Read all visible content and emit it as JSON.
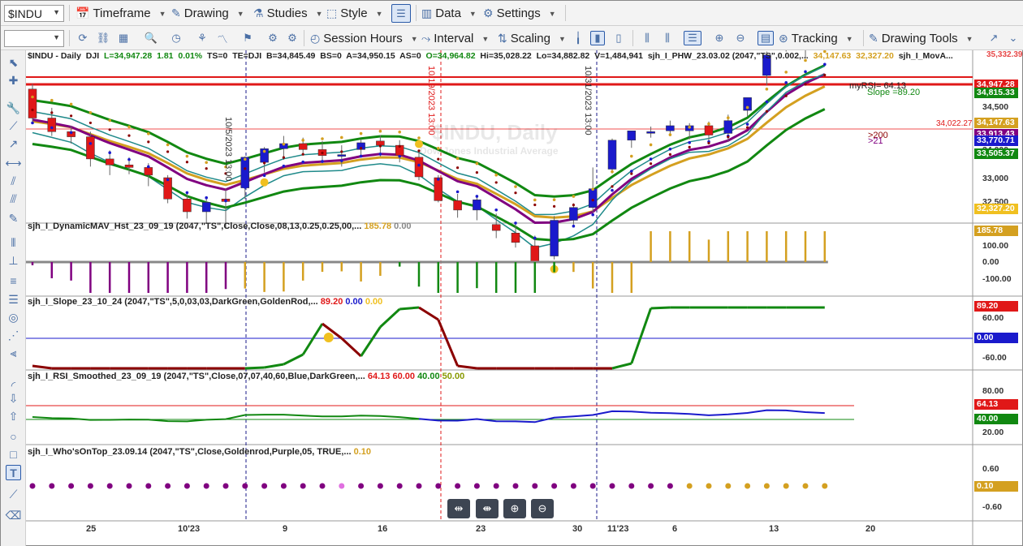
{
  "toolbar1": {
    "symbol": "$INDU",
    "timeframe": "Timeframe",
    "drawing": "Drawing",
    "studies": "Studies",
    "style": "Style",
    "data": "Data",
    "settings": "Settings"
  },
  "toolbar2": {
    "session_hours": "Session Hours",
    "interval": "Interval",
    "scaling": "Scaling",
    "tracking": "Tracking",
    "drawing_tools": "Drawing Tools"
  },
  "header": {
    "symbol": "$INDU - Daily",
    "exchange": "DJI",
    "last": "L=34,947.28",
    "change": "1.81",
    "pct": "0.01%",
    "ts": "TS=0",
    "te": "TE=DJI",
    "bid": "B=34,845.49",
    "bs": "BS=0",
    "ask": "A=34,950.15",
    "as": "AS=0",
    "open": "O=34,964.82",
    "high": "Hi=35,028.22",
    "low": "Lo=34,882.82",
    "vol": "V=1,484,941",
    "study1": "sjh_I_PHW_23.03.02 (2047,\"TS\",0.002,...",
    "study1_v1": "34,147.63",
    "study1_v2": "32,327.20",
    "study2": "sjh_I_MovA..."
  },
  "watermark": {
    "title": "$INDU, Daily",
    "sub": "Dow Jones Industrial Average"
  },
  "annotations": {
    "myrsi": "myRSI= 64.13",
    "slope": "Slope =89.20",
    "gt200": ">200",
    "gt21": ">21",
    "line_price": "34,022.27",
    "date1": "10/5/2023 13:00",
    "date2": "10/19/2023 13:00",
    "date3": "10/31/2023 13:00"
  },
  "price_scale": {
    "tags": [
      "34,947.28",
      "34,815.33",
      "34,147.63",
      "33,913.43",
      "33,770.71",
      "33,505.37",
      "32,327.20"
    ],
    "top_partial": "35,332.39",
    "ticks": [
      "34,500",
      "34,000",
      "33,500",
      "33,000",
      "32,500"
    ]
  },
  "pane2": {
    "title": "sjh_I_DynamicMAV_Hst_23_09_19 (2047,\"TS\",Close,Close,08,13,0.25,0.25,00,...",
    "v1": "185.78",
    "v2": "0.00",
    "tag": "185.78",
    "ticks": [
      "100.00",
      "0.00",
      "-100.00"
    ]
  },
  "pane3": {
    "title": "sjh_I_Slope_23_10_24 (2047,\"TS\",5,0,03,03,DarkGreen,GoldenRod,...",
    "v1": "89.20",
    "v2": "0.00",
    "v3": "0.00",
    "tags": [
      "89.20",
      "0.00"
    ],
    "ticks": [
      "60.00",
      "-60.00"
    ]
  },
  "pane4": {
    "title": "sjh_I_RSI_Smoothed_23_09_19 (2047,\"TS\",Close,07,07,40,60,Blue,DarkGreen,...",
    "v1": "64.13",
    "v2": "60.00",
    "v3": "40.00",
    "v4": "50.00",
    "tags": [
      "64.13",
      "40.00"
    ],
    "ticks": [
      "80.00",
      "20.00"
    ]
  },
  "pane5": {
    "title": "sjh_I_Who'sOnTop_23.09.14 (2047,\"TS\",Close,Goldenrod,Purple,05, TRUE,...",
    "v1": "0.10",
    "tag": "0.10",
    "ticks": [
      "0.60",
      "-0.60"
    ]
  },
  "xaxis": {
    "ticks": [
      "25",
      "10'23",
      "9",
      "16",
      "23",
      "30",
      "11'23",
      "6",
      "13",
      "20"
    ]
  },
  "colors": {
    "up": "#1a1acc",
    "down": "#e01818",
    "green": "#118811",
    "gold": "#d4a020",
    "purple": "#800080",
    "teal": "#1f8a8a",
    "darkred": "#8b0000"
  },
  "chart_data": {
    "type": "candlestick",
    "x": [
      "2023-09-21",
      "2023-09-22",
      "2023-09-25",
      "2023-09-26",
      "2023-09-27",
      "2023-09-28",
      "2023-09-29",
      "2023-10-02",
      "2023-10-03",
      "2023-10-04",
      "2023-10-05",
      "2023-10-06",
      "2023-10-09",
      "2023-10-10",
      "2023-10-11",
      "2023-10-12",
      "2023-10-13",
      "2023-10-16",
      "2023-10-17",
      "2023-10-18",
      "2023-10-19",
      "2023-10-20",
      "2023-10-23",
      "2023-10-24",
      "2023-10-25",
      "2023-10-26",
      "2023-10-27",
      "2023-10-30",
      "2023-10-31",
      "2023-11-01",
      "2023-11-02",
      "2023-11-03",
      "2023-11-06",
      "2023-11-07",
      "2023-11-08",
      "2023-11-09",
      "2023-11-10",
      "2023-11-13",
      "2023-11-14",
      "2023-11-15",
      "2023-11-16",
      "2023-11-17"
    ],
    "open": [
      34440,
      34100,
      33940,
      33880,
      33620,
      33550,
      33520,
      33400,
      33150,
      33000,
      33150,
      33280,
      33580,
      33740,
      33800,
      33730,
      33660,
      33730,
      33830,
      33780,
      33640,
      33400,
      33130,
      33020,
      32850,
      32750,
      32600,
      32480,
      32900,
      33050,
      33500,
      33840,
      33930,
      33950,
      33950,
      34010,
      33920,
      34190,
      34600,
      34960,
      34930,
      34950
    ],
    "high": [
      34500,
      34220,
      34010,
      33940,
      33720,
      33640,
      33570,
      33430,
      33230,
      33160,
      33270,
      33650,
      33760,
      33890,
      33870,
      33830,
      33780,
      33850,
      33900,
      33840,
      33700,
      33430,
      33210,
      33180,
      32980,
      32880,
      32720,
      32950,
      33100,
      33520,
      33860,
      33950,
      34000,
      34070,
      34040,
      34060,
      34140,
      34320,
      34880,
      35050,
      35040,
      35030
    ],
    "low": [
      34050,
      33890,
      33800,
      33530,
      33430,
      33440,
      33300,
      33100,
      32920,
      32860,
      32800,
      33150,
      33460,
      33610,
      33660,
      33570,
      33530,
      33640,
      33650,
      33580,
      33370,
      33110,
      32930,
      32900,
      32690,
      32580,
      32390,
      32440,
      32850,
      32990,
      33450,
      33750,
      33870,
      33890,
      33850,
      33790,
      33820,
      34120,
      34480,
      34880,
      34800,
      34880
    ],
    "close": [
      34100,
      33940,
      33880,
      33620,
      33550,
      33520,
      33430,
      33150,
      33000,
      33110,
      33120,
      33640,
      33740,
      33800,
      33730,
      33660,
      33670,
      33810,
      33780,
      33660,
      33410,
      33130,
      33020,
      33140,
      32780,
      32640,
      32420,
      32900,
      33050,
      33270,
      33840,
      33950,
      33940,
      34010,
      34010,
      33900,
      34070,
      34340,
      34840,
      34990,
      34940,
      34947
    ]
  }
}
